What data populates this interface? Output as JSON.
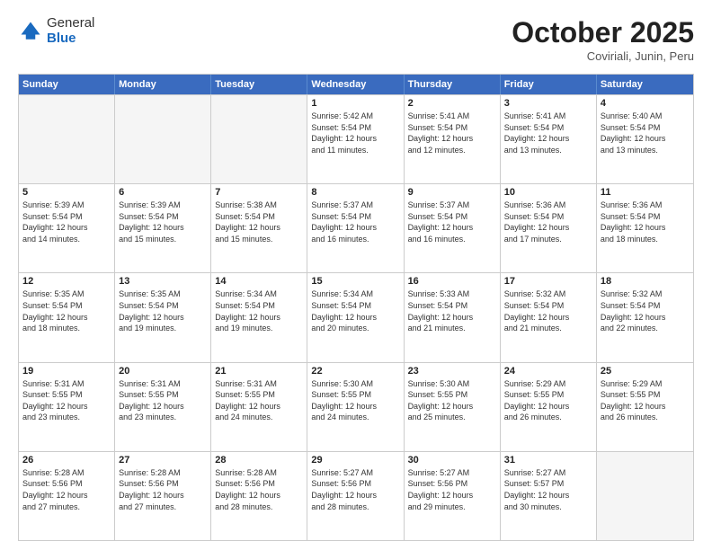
{
  "logo": {
    "general": "General",
    "blue": "Blue"
  },
  "header": {
    "title": "October 2025",
    "subtitle": "Coviriali, Junin, Peru"
  },
  "weekdays": [
    "Sunday",
    "Monday",
    "Tuesday",
    "Wednesday",
    "Thursday",
    "Friday",
    "Saturday"
  ],
  "rows": [
    [
      {
        "day": "",
        "info": "",
        "empty": true
      },
      {
        "day": "",
        "info": "",
        "empty": true
      },
      {
        "day": "",
        "info": "",
        "empty": true
      },
      {
        "day": "1",
        "info": "Sunrise: 5:42 AM\nSunset: 5:54 PM\nDaylight: 12 hours\nand 11 minutes.",
        "empty": false
      },
      {
        "day": "2",
        "info": "Sunrise: 5:41 AM\nSunset: 5:54 PM\nDaylight: 12 hours\nand 12 minutes.",
        "empty": false
      },
      {
        "day": "3",
        "info": "Sunrise: 5:41 AM\nSunset: 5:54 PM\nDaylight: 12 hours\nand 13 minutes.",
        "empty": false
      },
      {
        "day": "4",
        "info": "Sunrise: 5:40 AM\nSunset: 5:54 PM\nDaylight: 12 hours\nand 13 minutes.",
        "empty": false
      }
    ],
    [
      {
        "day": "5",
        "info": "Sunrise: 5:39 AM\nSunset: 5:54 PM\nDaylight: 12 hours\nand 14 minutes.",
        "empty": false
      },
      {
        "day": "6",
        "info": "Sunrise: 5:39 AM\nSunset: 5:54 PM\nDaylight: 12 hours\nand 15 minutes.",
        "empty": false
      },
      {
        "day": "7",
        "info": "Sunrise: 5:38 AM\nSunset: 5:54 PM\nDaylight: 12 hours\nand 15 minutes.",
        "empty": false
      },
      {
        "day": "8",
        "info": "Sunrise: 5:37 AM\nSunset: 5:54 PM\nDaylight: 12 hours\nand 16 minutes.",
        "empty": false
      },
      {
        "day": "9",
        "info": "Sunrise: 5:37 AM\nSunset: 5:54 PM\nDaylight: 12 hours\nand 16 minutes.",
        "empty": false
      },
      {
        "day": "10",
        "info": "Sunrise: 5:36 AM\nSunset: 5:54 PM\nDaylight: 12 hours\nand 17 minutes.",
        "empty": false
      },
      {
        "day": "11",
        "info": "Sunrise: 5:36 AM\nSunset: 5:54 PM\nDaylight: 12 hours\nand 18 minutes.",
        "empty": false
      }
    ],
    [
      {
        "day": "12",
        "info": "Sunrise: 5:35 AM\nSunset: 5:54 PM\nDaylight: 12 hours\nand 18 minutes.",
        "empty": false
      },
      {
        "day": "13",
        "info": "Sunrise: 5:35 AM\nSunset: 5:54 PM\nDaylight: 12 hours\nand 19 minutes.",
        "empty": false
      },
      {
        "day": "14",
        "info": "Sunrise: 5:34 AM\nSunset: 5:54 PM\nDaylight: 12 hours\nand 19 minutes.",
        "empty": false
      },
      {
        "day": "15",
        "info": "Sunrise: 5:34 AM\nSunset: 5:54 PM\nDaylight: 12 hours\nand 20 minutes.",
        "empty": false
      },
      {
        "day": "16",
        "info": "Sunrise: 5:33 AM\nSunset: 5:54 PM\nDaylight: 12 hours\nand 21 minutes.",
        "empty": false
      },
      {
        "day": "17",
        "info": "Sunrise: 5:32 AM\nSunset: 5:54 PM\nDaylight: 12 hours\nand 21 minutes.",
        "empty": false
      },
      {
        "day": "18",
        "info": "Sunrise: 5:32 AM\nSunset: 5:54 PM\nDaylight: 12 hours\nand 22 minutes.",
        "empty": false
      }
    ],
    [
      {
        "day": "19",
        "info": "Sunrise: 5:31 AM\nSunset: 5:55 PM\nDaylight: 12 hours\nand 23 minutes.",
        "empty": false
      },
      {
        "day": "20",
        "info": "Sunrise: 5:31 AM\nSunset: 5:55 PM\nDaylight: 12 hours\nand 23 minutes.",
        "empty": false
      },
      {
        "day": "21",
        "info": "Sunrise: 5:31 AM\nSunset: 5:55 PM\nDaylight: 12 hours\nand 24 minutes.",
        "empty": false
      },
      {
        "day": "22",
        "info": "Sunrise: 5:30 AM\nSunset: 5:55 PM\nDaylight: 12 hours\nand 24 minutes.",
        "empty": false
      },
      {
        "day": "23",
        "info": "Sunrise: 5:30 AM\nSunset: 5:55 PM\nDaylight: 12 hours\nand 25 minutes.",
        "empty": false
      },
      {
        "day": "24",
        "info": "Sunrise: 5:29 AM\nSunset: 5:55 PM\nDaylight: 12 hours\nand 26 minutes.",
        "empty": false
      },
      {
        "day": "25",
        "info": "Sunrise: 5:29 AM\nSunset: 5:55 PM\nDaylight: 12 hours\nand 26 minutes.",
        "empty": false
      }
    ],
    [
      {
        "day": "26",
        "info": "Sunrise: 5:28 AM\nSunset: 5:56 PM\nDaylight: 12 hours\nand 27 minutes.",
        "empty": false
      },
      {
        "day": "27",
        "info": "Sunrise: 5:28 AM\nSunset: 5:56 PM\nDaylight: 12 hours\nand 27 minutes.",
        "empty": false
      },
      {
        "day": "28",
        "info": "Sunrise: 5:28 AM\nSunset: 5:56 PM\nDaylight: 12 hours\nand 28 minutes.",
        "empty": false
      },
      {
        "day": "29",
        "info": "Sunrise: 5:27 AM\nSunset: 5:56 PM\nDaylight: 12 hours\nand 28 minutes.",
        "empty": false
      },
      {
        "day": "30",
        "info": "Sunrise: 5:27 AM\nSunset: 5:56 PM\nDaylight: 12 hours\nand 29 minutes.",
        "empty": false
      },
      {
        "day": "31",
        "info": "Sunrise: 5:27 AM\nSunset: 5:57 PM\nDaylight: 12 hours\nand 30 minutes.",
        "empty": false
      },
      {
        "day": "",
        "info": "",
        "empty": true
      }
    ]
  ]
}
